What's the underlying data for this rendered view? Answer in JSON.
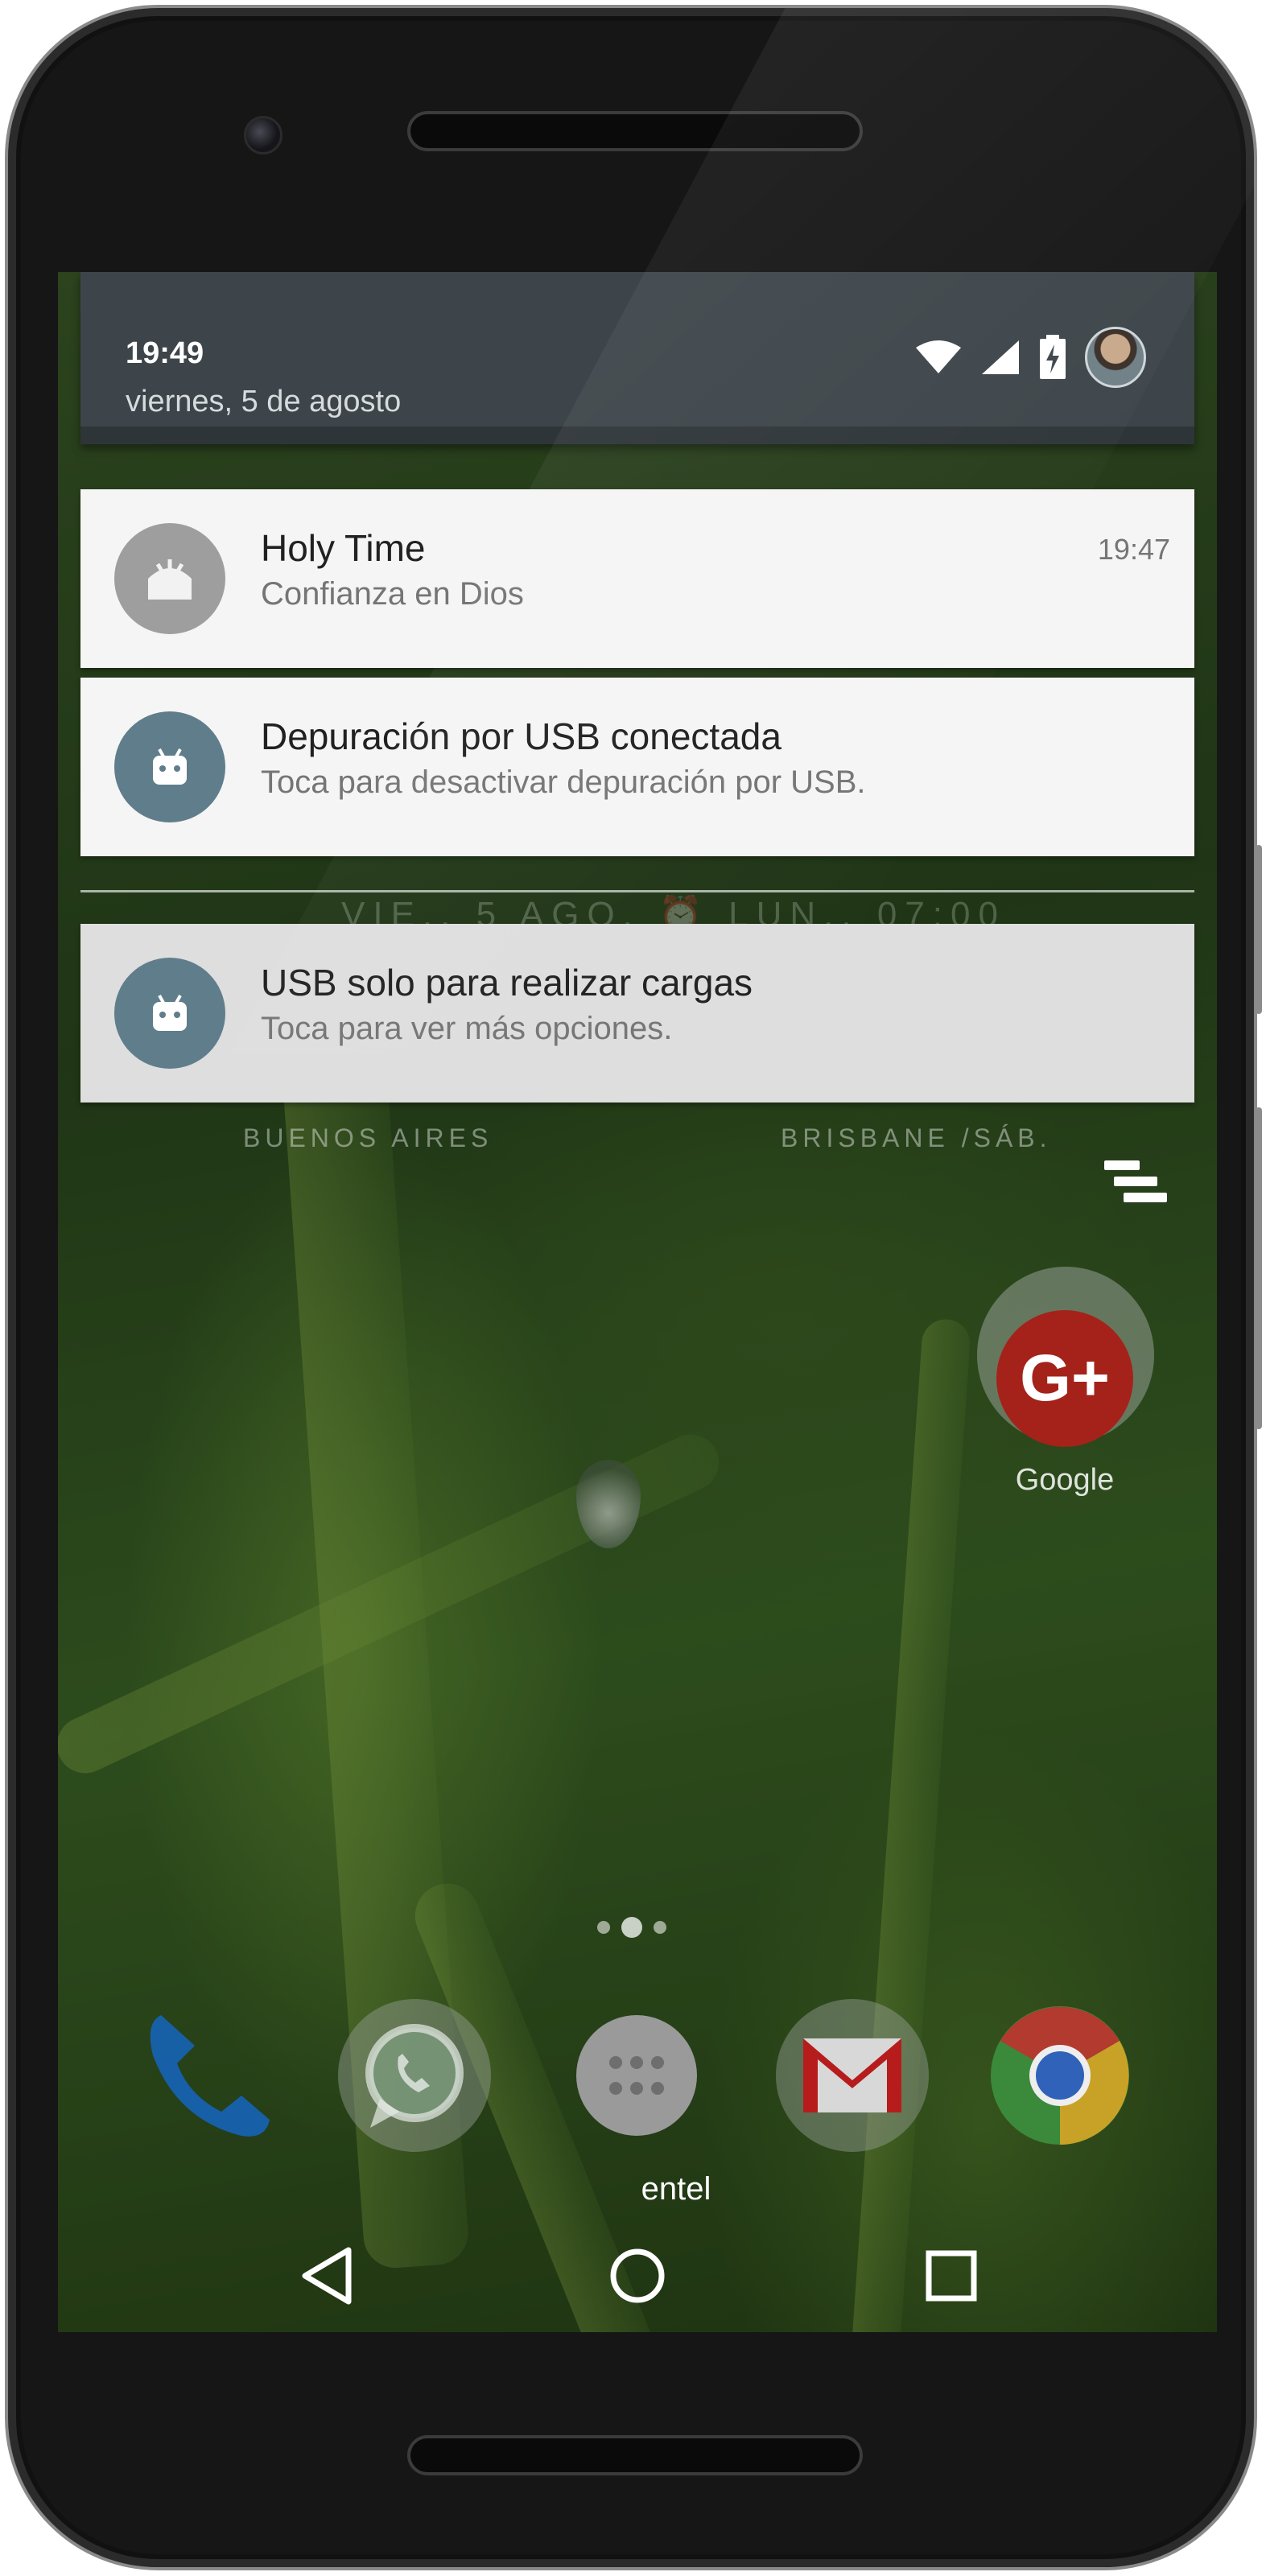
{
  "status_bar": {
    "time": "19:49",
    "date": "viernes, 5 de agosto",
    "icons": [
      "wifi-icon",
      "signal-icon",
      "battery-charging-icon",
      "user-avatar"
    ]
  },
  "notifications": [
    {
      "title": "Holy Time",
      "text": "Confianza en Dios",
      "time": "19:47",
      "icon": "holy-time-app-icon"
    },
    {
      "title": "Depuración por USB conectada",
      "text": "Toca para desactivar depuración por USB.",
      "icon": "android-icon"
    },
    {
      "title": "USB solo para realizar cargas",
      "text": "Toca para ver más opciones.",
      "icon": "android-icon"
    }
  ],
  "clock_widget": {
    "date_alarm": "VIE., 5 AGO.",
    "alarm": "LUN., 07:00",
    "cities": [
      "BUENOS AIRES",
      "BRISBANE /SÁB."
    ]
  },
  "home": {
    "google_folder_label": "Google",
    "gplus_label": "G+",
    "app_drawer_label": "entel",
    "dock": [
      "phone-icon",
      "whatsapp-icon",
      "app-drawer-icon",
      "gmail-icon",
      "chrome-icon"
    ]
  },
  "colors": {
    "shade_header": "#3d454a",
    "notification_bg": "#f5f5f5",
    "notification_selected_bg": "#dedede",
    "android_icon_bg": "#607d8b",
    "holy_time_icon_bg": "#9e9e9e"
  }
}
